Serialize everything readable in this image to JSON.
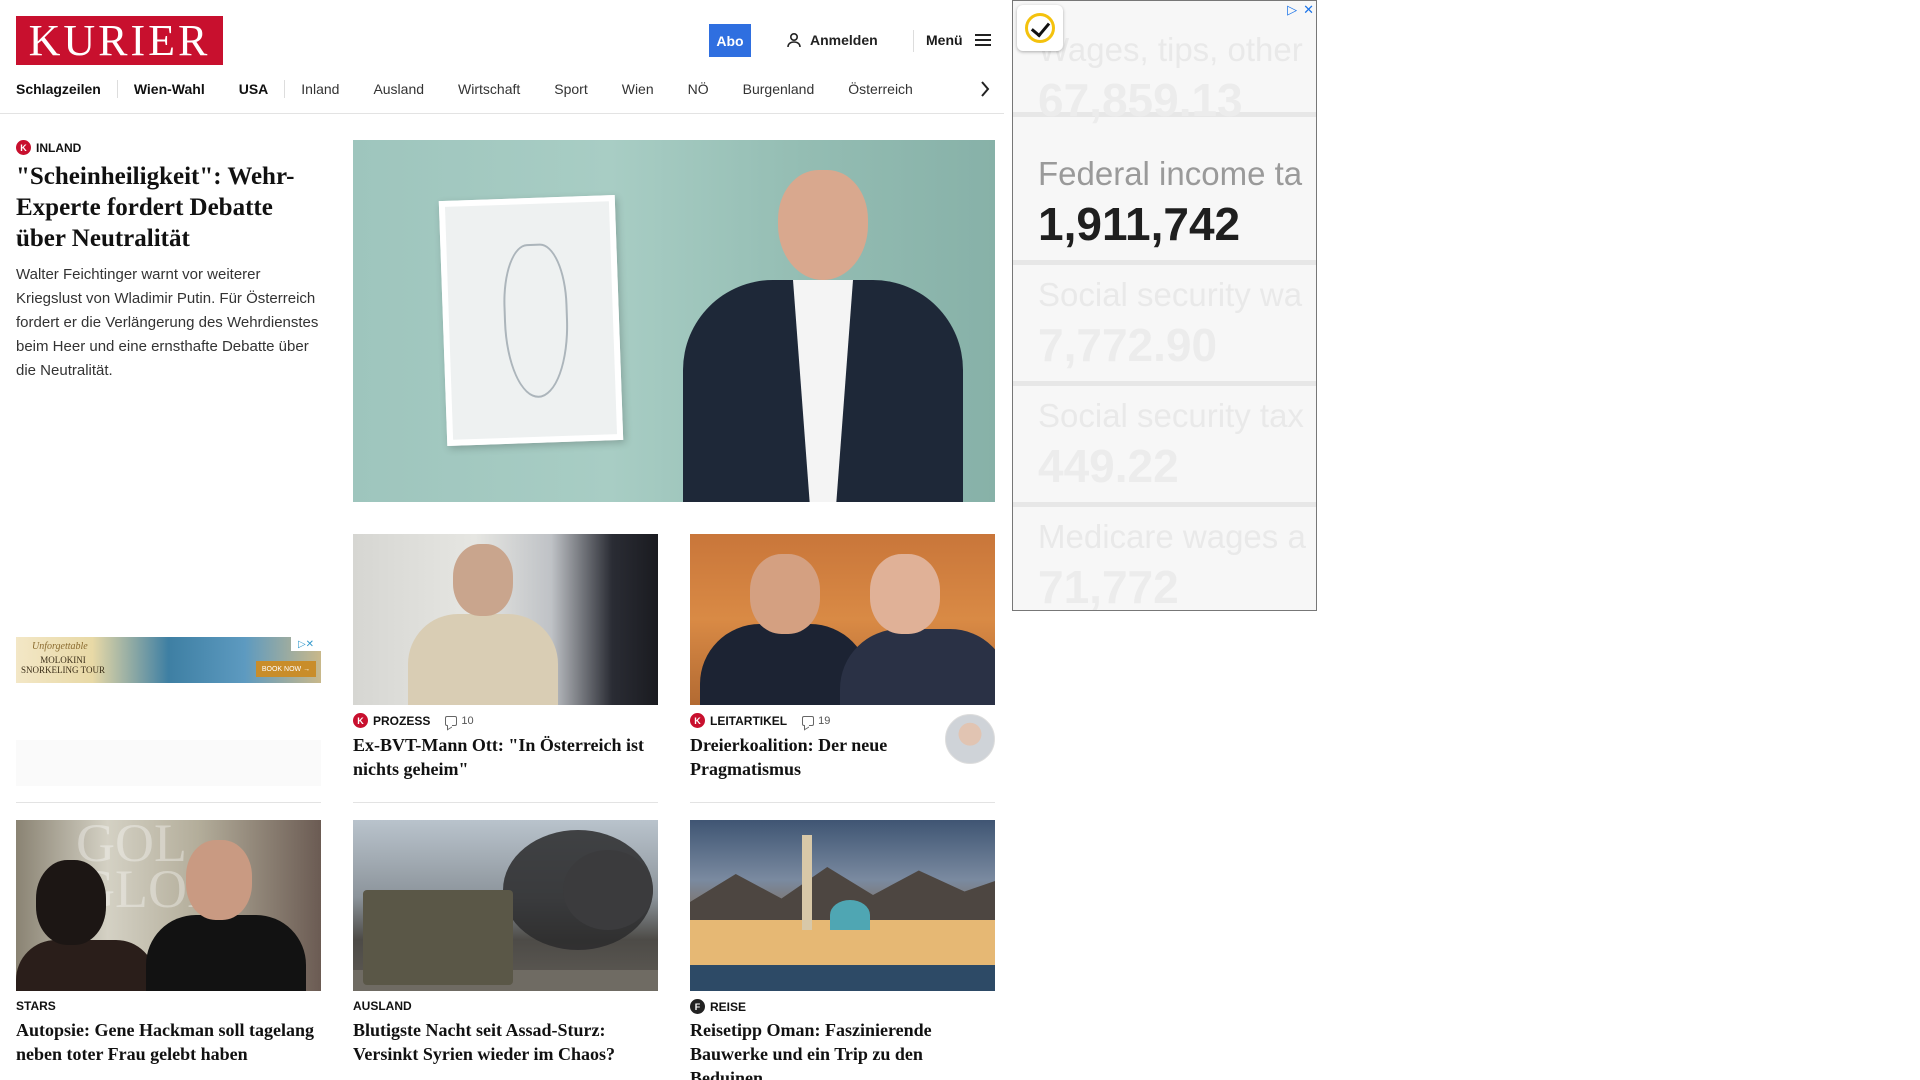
{
  "header": {
    "logo": "KURIER",
    "abo_label": "Abo",
    "login_label": "Anmelden",
    "menu_label": "Menü",
    "brand_color": "#c8102e",
    "abo_color": "#2f6fe0"
  },
  "nav": {
    "items": [
      "Schlagzeilen",
      "Wien-Wahl",
      "USA",
      "Inland",
      "Ausland",
      "Wirtschaft",
      "Sport",
      "Wien",
      "NÖ",
      "Burgenland",
      "Österreich"
    ],
    "arrow_icon": "chevron-right-icon"
  },
  "lead": {
    "category": "INLAND",
    "title": "\"Scheinheiligkeit\": Wehr-Experte fordert Debatte über Neutralität",
    "text": "Walter Feichtinger warnt vor weiterer Kriegslust von Wladimir Putin. Für Österreich fordert er die Verlängerung des Wehrdienstes beim Heer und eine ernsthafte Debatte über die Neutralität."
  },
  "ad_left": {
    "line1": "Unforgettable",
    "line2": "MOLOKINI SNORKELING TOUR",
    "button": "BOOK NOW →"
  },
  "cards_row1": [
    {
      "category": "PROZESS",
      "comments": "10",
      "title": "Ex-BVT-Mann Ott: \"In Österreich ist nichts geheim\""
    },
    {
      "category": "LEITARTIKEL",
      "comments": "19",
      "title": "Dreierkoalition: Der neue Pragmatismus"
    }
  ],
  "cards_row2": [
    {
      "category": "STARS",
      "title": "Autopsie: Gene Hackman soll tagelang neben toter Frau gelebt haben"
    },
    {
      "category": "AUSLAND",
      "title": "Blutigste Nacht seit Assad-Sturz: Versinkt Syrien wieder im Chaos?"
    },
    {
      "category": "REISE",
      "title": "Reisetipp Oman: Faszinierende Bauwerke und ein Trip zu den Beduinen"
    }
  ],
  "ad_right": {
    "rows": [
      {
        "label": "Wages, tips, other",
        "value": "67,859.13"
      },
      {
        "label": "Federal income ta",
        "value": "1,911,742"
      },
      {
        "label": "Social security wa",
        "value": "7,772.90"
      },
      {
        "label": "Social security tax",
        "value": "449.22"
      },
      {
        "label": "Medicare wages a",
        "value": "71,772"
      }
    ]
  }
}
